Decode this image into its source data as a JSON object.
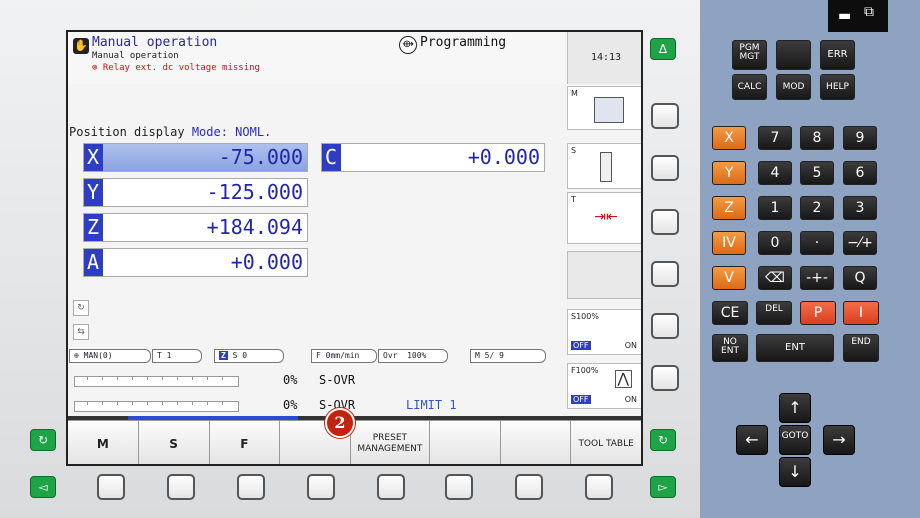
{
  "header": {
    "mode_primary": "Manual operation",
    "mode_sub": "Manual operation",
    "error_msg": "Relay ext. dc voltage missing",
    "mode_secondary": "Programming",
    "clock": "14:13"
  },
  "position": {
    "title": "Position display",
    "mode_label": "Mode: NOML.",
    "axes": [
      {
        "label": "X",
        "value": "-75.000"
      },
      {
        "label": "Y",
        "value": "-125.000"
      },
      {
        "label": "Z",
        "value": "+184.094"
      },
      {
        "label": "A",
        "value": "+0.000"
      },
      {
        "label": "C",
        "value": "+0.000"
      }
    ]
  },
  "status": {
    "manual": "MAN(0)",
    "tool": "T 1",
    "spindle_axis": "Z",
    "speed": "S 0",
    "feed": "F 0mm/min",
    "ovr_label": "Ovr",
    "ovr_value": "100%",
    "m_func": "M 5/ 9"
  },
  "overrides": [
    {
      "pct": "0%",
      "name": "S-OVR"
    },
    {
      "pct": "0%",
      "name": "S-OVR"
    }
  ],
  "limit": "LIMIT 1",
  "side_panel": {
    "m": "M",
    "s": "S",
    "t": "T",
    "s_override": "S100%",
    "f_override": "F100%",
    "off": "OFF",
    "on": "ON"
  },
  "softkeys": [
    "M",
    "S",
    "F",
    "",
    "PRESET MANAGEMENT",
    "",
    "",
    "TOOL TABLE"
  ],
  "badge": "2",
  "keypad": {
    "row1": [
      "PGM MGT",
      "",
      "ERR"
    ],
    "row2": [
      "CALC",
      "MOD",
      "HELP"
    ],
    "axis_keys": [
      "X",
      "Y",
      "Z",
      "IV",
      "V"
    ],
    "digits": [
      [
        "7",
        "8",
        "9"
      ],
      [
        "4",
        "5",
        "6"
      ],
      [
        "1",
        "2",
        "3"
      ],
      [
        "0",
        "·",
        "−⁄+"
      ]
    ],
    "misc": [
      "⌫",
      "-+-",
      "Q"
    ],
    "ce_row": [
      "CE",
      "DEL",
      "P",
      "I"
    ],
    "ent_row": [
      "NO ENT",
      "ENT",
      "END"
    ],
    "goto": "GOTO",
    "arrows": {
      "up": "↑",
      "down": "↓",
      "left": "←",
      "right": "→"
    }
  },
  "colors": {
    "accent": "#2d3ec4",
    "error": "#d01010",
    "green_btn": "#1ea347",
    "orange": "#e8782a",
    "red_key": "#e5502c"
  }
}
